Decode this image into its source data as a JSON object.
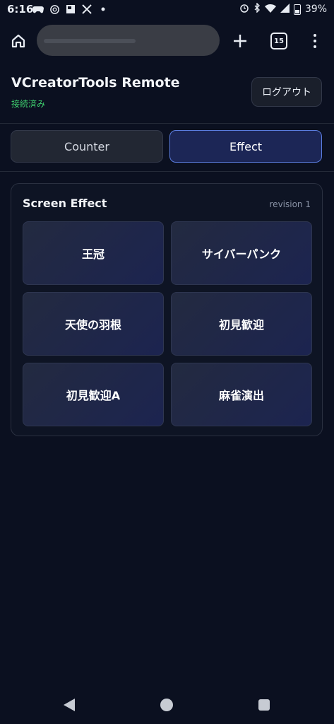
{
  "status_bar": {
    "time": "6:16",
    "battery": "39%",
    "left_icons": [
      "game-controller-icon",
      "openai-icon",
      "news-icon",
      "x-icon",
      "dot-icon"
    ],
    "right_icons": [
      "alarm-icon",
      "bluetooth-icon",
      "wifi-icon",
      "signal-icon",
      "battery-icon"
    ]
  },
  "browser": {
    "tab_count": "15",
    "url": ""
  },
  "app": {
    "title": "VCreatorTools Remote",
    "connection_status": "接続済み",
    "logout_label": "ログアウト"
  },
  "tabs": [
    {
      "label": "Counter",
      "active": false
    },
    {
      "label": "Effect",
      "active": true
    }
  ],
  "panel": {
    "title": "Screen Effect",
    "revision": "revision 1",
    "effects": [
      {
        "label": "王冠"
      },
      {
        "label": "サイバーパンク"
      },
      {
        "label": "天使の羽根"
      },
      {
        "label": "初見歓迎"
      },
      {
        "label": "初見歓迎A"
      },
      {
        "label": "麻雀演出"
      }
    ]
  },
  "colors": {
    "background": "#0b1020",
    "connected": "#3ecf6e",
    "active_tab_bg": "#1c2656",
    "active_tab_border": "#5b7de0"
  }
}
